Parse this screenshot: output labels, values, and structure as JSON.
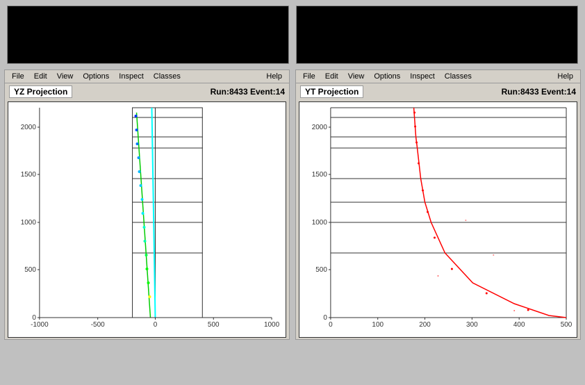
{
  "topBoxes": {
    "left": {
      "label": "left-preview"
    },
    "right": {
      "label": "right-preview",
      "bottomText": ""
    }
  },
  "leftPanel": {
    "menuItems": [
      "File",
      "Edit",
      "View",
      "Options",
      "Inspect",
      "Classes"
    ],
    "helpLabel": "Help",
    "title": "YZ Projection",
    "eventInfo": "Run:8433 Event:14",
    "chart": {
      "xAxisMin": -1000,
      "xAxisMax": 1000,
      "yAxisMin": 0,
      "yAxisMax": 2200,
      "xTicks": [
        "-1000",
        "-500",
        "0",
        "500",
        "1000"
      ],
      "yTicks": [
        "0",
        "500",
        "1000",
        "1500",
        "2000"
      ]
    }
  },
  "rightPanel": {
    "menuItems": [
      "File",
      "Edit",
      "View",
      "Options",
      "Inspect",
      "Classes"
    ],
    "helpLabel": "Help",
    "title": "YT Projection",
    "eventInfo": "Run:8433 Event:14",
    "chart": {
      "xAxisMin": 0,
      "xAxisMax": 500,
      "yAxisMin": 0,
      "yAxisMax": 2200,
      "xTicks": [
        "0",
        "100",
        "200",
        "300",
        "400",
        "500"
      ],
      "yTicks": [
        "0",
        "500",
        "1000",
        "1500",
        "2000"
      ]
    }
  }
}
